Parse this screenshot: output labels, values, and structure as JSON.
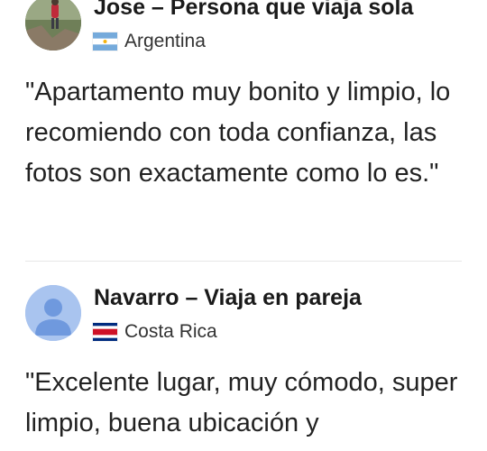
{
  "reviews": [
    {
      "name": "Jose – Persona que viaja sola",
      "country": "Argentina",
      "flag": "argentina-flag",
      "avatar": "user-photo",
      "text": "\"Apartamento muy bonito y limpio, lo recomiendo con toda confianza, las fotos son exactamente como lo es.\""
    },
    {
      "name": "Navarro – Viaja en pareja",
      "country": "Costa Rica",
      "flag": "costa-rica-flag",
      "avatar": "default-user-icon",
      "text": "\"Excelente lugar, muy cómodo, super limpio, buena ubicación y"
    }
  ],
  "colors": {
    "avatar_default_bg": "#a9c4ef",
    "avatar_default_fg": "#6f99de",
    "argentina_blue": "#75aadb",
    "costa_rica_red": "#ce1126",
    "costa_rica_blue": "#002b7f"
  }
}
